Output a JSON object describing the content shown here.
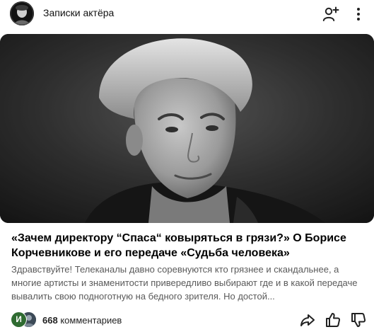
{
  "channel": {
    "name": "Записки актёра"
  },
  "article": {
    "title": "«Зачем директору “Спаса“ ковыряться в грязи?» О Борисе Корчевникове и его передаче «Судьба человека»",
    "snippet": "Здравствуйте! Телеканалы давно соревнуются кто грязнее и скандальнее, а многие артисты и знаменитости привередливо выбирают где и в какой передаче вывалить свою подноготную на бедного зрителя. Но достой..."
  },
  "footer": {
    "commenter_initial": "И",
    "comments_count": "668",
    "comments_label": "комментариев"
  },
  "icons": {
    "subscribe": "add-user-icon",
    "menu": "more-vertical-icon",
    "share": "share-icon",
    "like": "thumbs-up-icon",
    "dislike": "thumbs-down-icon"
  },
  "colors": {
    "commenter_badge": "#2f6b31",
    "snippet_text": "#5a5a5a"
  }
}
